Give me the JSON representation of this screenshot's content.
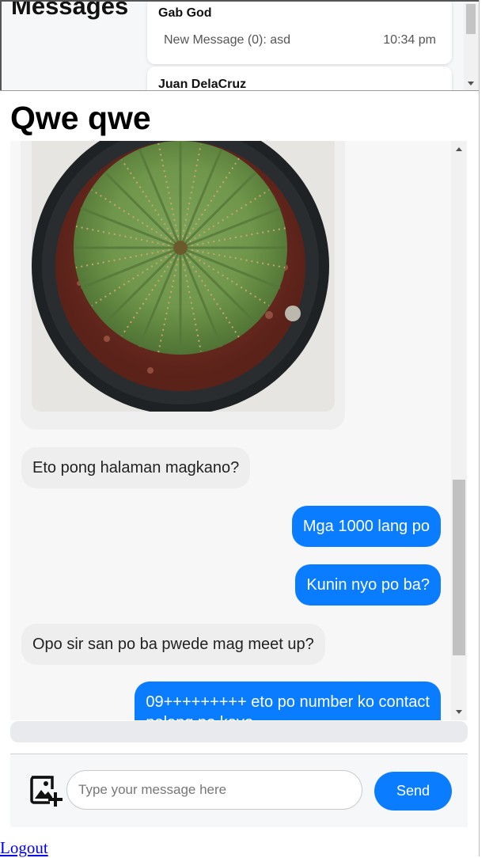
{
  "sidebar": {
    "heading": "Messages",
    "conversations": [
      {
        "name": "Gab God",
        "preview": "New Message (0): asd",
        "time": "10:34 pm"
      },
      {
        "name": "Juan DelaCruz"
      }
    ]
  },
  "chat": {
    "title": "Qwe qwe",
    "messages": [
      {
        "type": "image",
        "direction": "in",
        "alt": "cactus-photo"
      },
      {
        "type": "text",
        "direction": "in",
        "text": "Eto pong halaman magkano?"
      },
      {
        "type": "text",
        "direction": "out",
        "text": "Mga 1000 lang po"
      },
      {
        "type": "text",
        "direction": "out",
        "text": "Kunin nyo po ba?"
      },
      {
        "type": "text",
        "direction": "in",
        "text": "Opo sir san po ba pwede mag meet up?"
      },
      {
        "type": "text",
        "direction": "out",
        "text": "09+++++++++ eto po number ko contact",
        "text2": "nalang po kayo"
      }
    ]
  },
  "composer": {
    "placeholder": "Type your message here",
    "send_label": "Send",
    "attach_icon": "add-photo-icon"
  },
  "footer": {
    "logout_label": "Logout"
  },
  "colors": {
    "accent": "#0a7cff",
    "incoming_bubble": "#eeeeee",
    "panel_bg": "#f6f7f9"
  }
}
